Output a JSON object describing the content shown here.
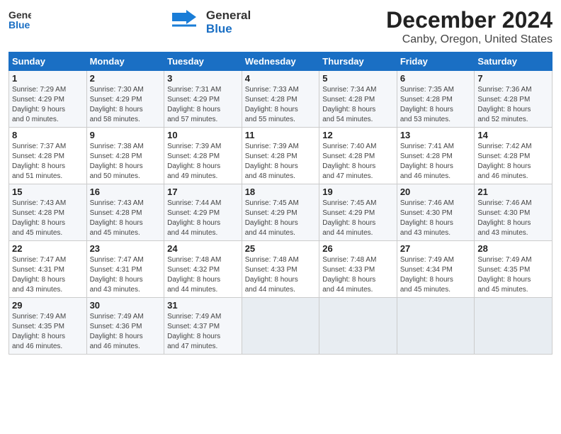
{
  "header": {
    "logo_line1": "General",
    "logo_line2": "Blue",
    "title": "December 2024",
    "subtitle": "Canby, Oregon, United States"
  },
  "calendar": {
    "days_of_week": [
      "Sunday",
      "Monday",
      "Tuesday",
      "Wednesday",
      "Thursday",
      "Friday",
      "Saturday"
    ],
    "weeks": [
      [
        {
          "day": "1",
          "info": "Sunrise: 7:29 AM\nSunset: 4:29 PM\nDaylight: 9 hours\nand 0 minutes."
        },
        {
          "day": "2",
          "info": "Sunrise: 7:30 AM\nSunset: 4:29 PM\nDaylight: 8 hours\nand 58 minutes."
        },
        {
          "day": "3",
          "info": "Sunrise: 7:31 AM\nSunset: 4:29 PM\nDaylight: 8 hours\nand 57 minutes."
        },
        {
          "day": "4",
          "info": "Sunrise: 7:33 AM\nSunset: 4:28 PM\nDaylight: 8 hours\nand 55 minutes."
        },
        {
          "day": "5",
          "info": "Sunrise: 7:34 AM\nSunset: 4:28 PM\nDaylight: 8 hours\nand 54 minutes."
        },
        {
          "day": "6",
          "info": "Sunrise: 7:35 AM\nSunset: 4:28 PM\nDaylight: 8 hours\nand 53 minutes."
        },
        {
          "day": "7",
          "info": "Sunrise: 7:36 AM\nSunset: 4:28 PM\nDaylight: 8 hours\nand 52 minutes."
        }
      ],
      [
        {
          "day": "8",
          "info": "Sunrise: 7:37 AM\nSunset: 4:28 PM\nDaylight: 8 hours\nand 51 minutes."
        },
        {
          "day": "9",
          "info": "Sunrise: 7:38 AM\nSunset: 4:28 PM\nDaylight: 8 hours\nand 50 minutes."
        },
        {
          "day": "10",
          "info": "Sunrise: 7:39 AM\nSunset: 4:28 PM\nDaylight: 8 hours\nand 49 minutes."
        },
        {
          "day": "11",
          "info": "Sunrise: 7:39 AM\nSunset: 4:28 PM\nDaylight: 8 hours\nand 48 minutes."
        },
        {
          "day": "12",
          "info": "Sunrise: 7:40 AM\nSunset: 4:28 PM\nDaylight: 8 hours\nand 47 minutes."
        },
        {
          "day": "13",
          "info": "Sunrise: 7:41 AM\nSunset: 4:28 PM\nDaylight: 8 hours\nand 46 minutes."
        },
        {
          "day": "14",
          "info": "Sunrise: 7:42 AM\nSunset: 4:28 PM\nDaylight: 8 hours\nand 46 minutes."
        }
      ],
      [
        {
          "day": "15",
          "info": "Sunrise: 7:43 AM\nSunset: 4:28 PM\nDaylight: 8 hours\nand 45 minutes."
        },
        {
          "day": "16",
          "info": "Sunrise: 7:43 AM\nSunset: 4:28 PM\nDaylight: 8 hours\nand 45 minutes."
        },
        {
          "day": "17",
          "info": "Sunrise: 7:44 AM\nSunset: 4:29 PM\nDaylight: 8 hours\nand 44 minutes."
        },
        {
          "day": "18",
          "info": "Sunrise: 7:45 AM\nSunset: 4:29 PM\nDaylight: 8 hours\nand 44 minutes."
        },
        {
          "day": "19",
          "info": "Sunrise: 7:45 AM\nSunset: 4:29 PM\nDaylight: 8 hours\nand 44 minutes."
        },
        {
          "day": "20",
          "info": "Sunrise: 7:46 AM\nSunset: 4:30 PM\nDaylight: 8 hours\nand 43 minutes."
        },
        {
          "day": "21",
          "info": "Sunrise: 7:46 AM\nSunset: 4:30 PM\nDaylight: 8 hours\nand 43 minutes."
        }
      ],
      [
        {
          "day": "22",
          "info": "Sunrise: 7:47 AM\nSunset: 4:31 PM\nDaylight: 8 hours\nand 43 minutes."
        },
        {
          "day": "23",
          "info": "Sunrise: 7:47 AM\nSunset: 4:31 PM\nDaylight: 8 hours\nand 43 minutes."
        },
        {
          "day": "24",
          "info": "Sunrise: 7:48 AM\nSunset: 4:32 PM\nDaylight: 8 hours\nand 44 minutes."
        },
        {
          "day": "25",
          "info": "Sunrise: 7:48 AM\nSunset: 4:33 PM\nDaylight: 8 hours\nand 44 minutes."
        },
        {
          "day": "26",
          "info": "Sunrise: 7:48 AM\nSunset: 4:33 PM\nDaylight: 8 hours\nand 44 minutes."
        },
        {
          "day": "27",
          "info": "Sunrise: 7:49 AM\nSunset: 4:34 PM\nDaylight: 8 hours\nand 45 minutes."
        },
        {
          "day": "28",
          "info": "Sunrise: 7:49 AM\nSunset: 4:35 PM\nDaylight: 8 hours\nand 45 minutes."
        }
      ],
      [
        {
          "day": "29",
          "info": "Sunrise: 7:49 AM\nSunset: 4:35 PM\nDaylight: 8 hours\nand 46 minutes."
        },
        {
          "day": "30",
          "info": "Sunrise: 7:49 AM\nSunset: 4:36 PM\nDaylight: 8 hours\nand 46 minutes."
        },
        {
          "day": "31",
          "info": "Sunrise: 7:49 AM\nSunset: 4:37 PM\nDaylight: 8 hours\nand 47 minutes."
        },
        {
          "day": "",
          "info": ""
        },
        {
          "day": "",
          "info": ""
        },
        {
          "day": "",
          "info": ""
        },
        {
          "day": "",
          "info": ""
        }
      ]
    ]
  }
}
